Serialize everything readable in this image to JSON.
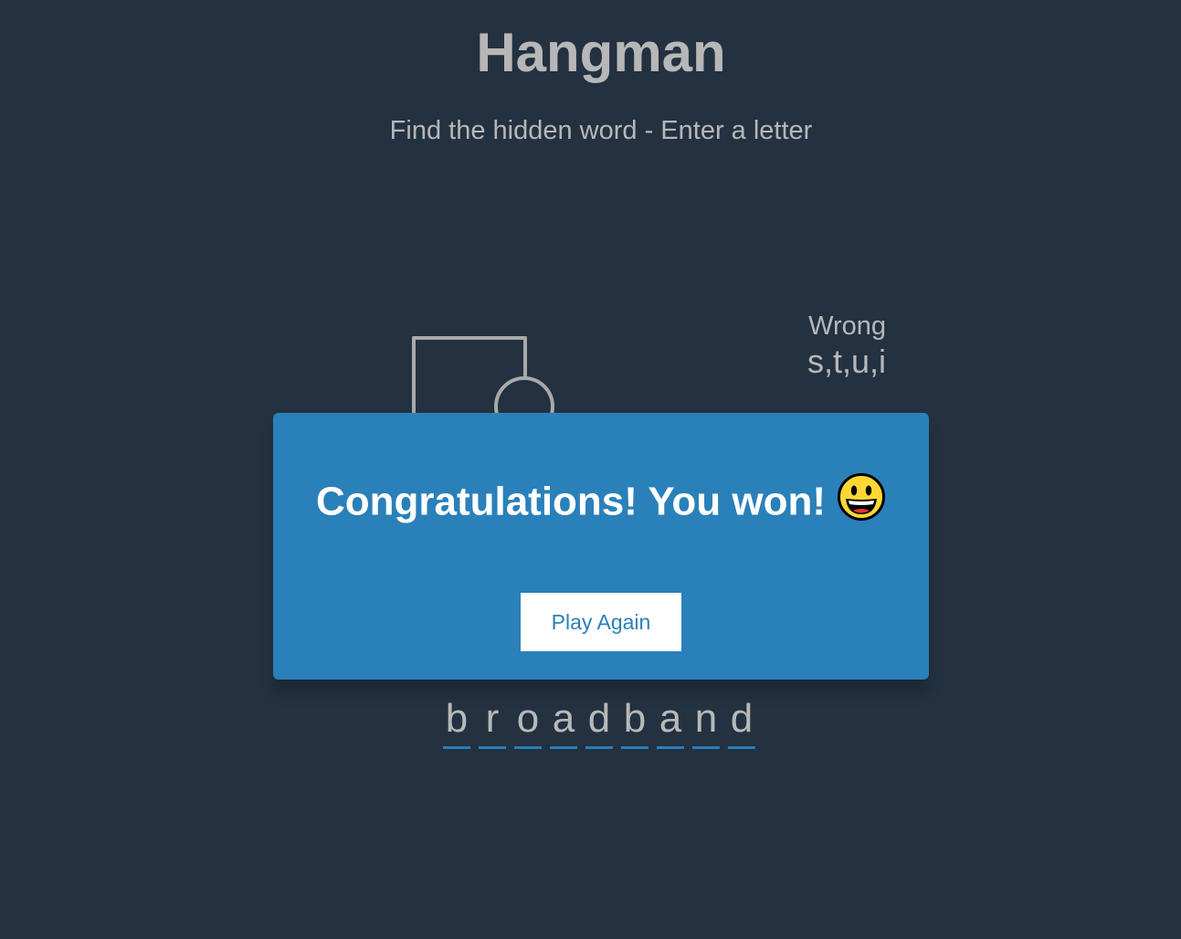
{
  "game": {
    "title": "Hangman",
    "subtitle": "Find the hidden word - Enter a letter"
  },
  "wrong": {
    "label": "Wrong",
    "letters": "s,t,u,i"
  },
  "word": {
    "letters": [
      "b",
      "r",
      "o",
      "a",
      "d",
      "b",
      "a",
      "n",
      "d"
    ]
  },
  "popup": {
    "message": "Congratulations! You won!",
    "button_label": "Play Again",
    "emoji_icon": "grinning-face-icon"
  },
  "colors": {
    "background": "#233141",
    "popup": "#2a80b9",
    "underline": "#2a7db7"
  }
}
